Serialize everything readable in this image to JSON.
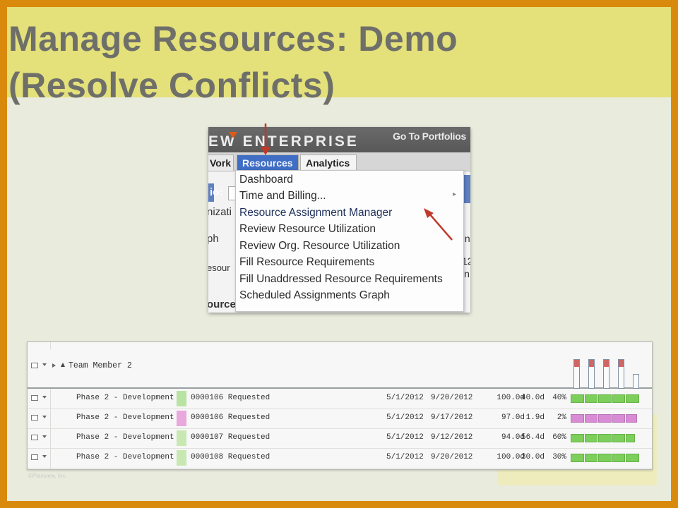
{
  "slide": {
    "title_line1": "Manage Resources: Demo",
    "title_line2": "(Resolve Conflicts)",
    "copyright": "©Planview, Inc."
  },
  "menu_screenshot": {
    "brand": "EW ENTERPRISE",
    "go_to_portfolios": "Go To Portfolios",
    "tabs": {
      "work": "Vork",
      "resources": "Resources",
      "analytics": "Analytics"
    },
    "background_fragments": {
      "f1": "io:",
      "f2": "nizati",
      "f3": "ph",
      "f4": "esour",
      "f5": "ource",
      "r1": "In",
      "r2": "12",
      "r3": "in"
    },
    "dropdown_items": [
      "Dashboard",
      "Time and Billing...",
      "Resource Assignment Manager",
      "Review Resource Utilization",
      "Review Org. Resource Utilization",
      "Fill Resource Requirements",
      "Fill Unaddressed Resource Requirements",
      "Scheduled Assignments Graph"
    ],
    "colors": {
      "active_tab": "#3f6ec4",
      "brand_accent": "#e05a1a",
      "annotation_arrow": "#c0392b"
    }
  },
  "resource_table": {
    "member_name": "Team Member 2",
    "histogram_levels": [
      1.0,
      1.0,
      1.0,
      1.0,
      0.5
    ],
    "rows": [
      {
        "phase": "Phase 2 - Development",
        "request": "0000106 Requested",
        "start": "5/1/2012",
        "finish": "9/20/2012",
        "work": "100.0d",
        "actual": "40.0d",
        "pct": "40%",
        "color": "#b9e3a2",
        "bar_color": "#7ccf5a",
        "bar_fill": 1.0
      },
      {
        "phase": "Phase 2 - Development",
        "request": "0000106 Requested",
        "start": "5/1/2012",
        "finish": "9/17/2012",
        "work": "97.0d",
        "actual": "1.9d",
        "pct": "2%",
        "color": "#e9a8dc",
        "bar_color": "#d98bd6",
        "bar_fill": 0.97
      },
      {
        "phase": "Phase 2 - Development",
        "request": "0000107 Requested",
        "start": "5/1/2012",
        "finish": "9/12/2012",
        "work": "94.0d",
        "actual": "56.4d",
        "pct": "60%",
        "color": "#c8e8b3",
        "bar_color": "#7ccf5a",
        "bar_fill": 0.94
      },
      {
        "phase": "Phase 2 - Development",
        "request": "0000108 Requested",
        "start": "5/1/2012",
        "finish": "9/20/2012",
        "work": "100.0d",
        "actual": "30.0d",
        "pct": "30%",
        "color": "#c8e8b3",
        "bar_color": "#7ccf5a",
        "bar_fill": 1.0
      }
    ]
  }
}
